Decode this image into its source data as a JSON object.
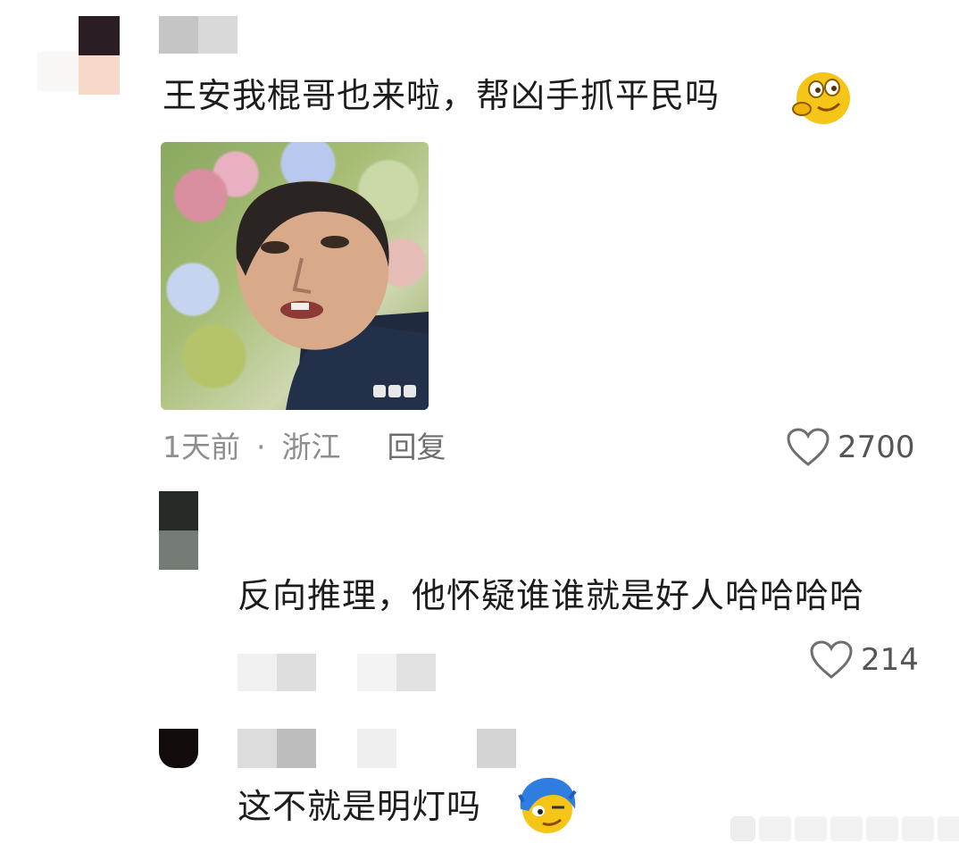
{
  "comments": [
    {
      "text": "王安我棍哥也来啦，帮凶手抓平民吗",
      "emoji_icon": "thinking-smirk-emoji-icon",
      "has_image": true,
      "image_icon": "meme-face-photo",
      "time": "1天前",
      "separator": "·",
      "location": "浙江",
      "reply_label": "回复",
      "likes": "2700"
    },
    {
      "text": "反向推理，他怀疑谁谁就是好人哈哈哈哈",
      "likes": "214"
    },
    {
      "text": "这不就是明灯吗",
      "emoji_icon": "blue-hair-smirk-emoji-icon"
    }
  ],
  "icons": {
    "like": "heart-outline-icon",
    "avatar": "mosaic-avatar"
  },
  "colors": {
    "text": "#1c1c1c",
    "meta": "#8e8e8e",
    "emoji_yellow": "#f5c518",
    "emoji_blue": "#2f7de1"
  }
}
